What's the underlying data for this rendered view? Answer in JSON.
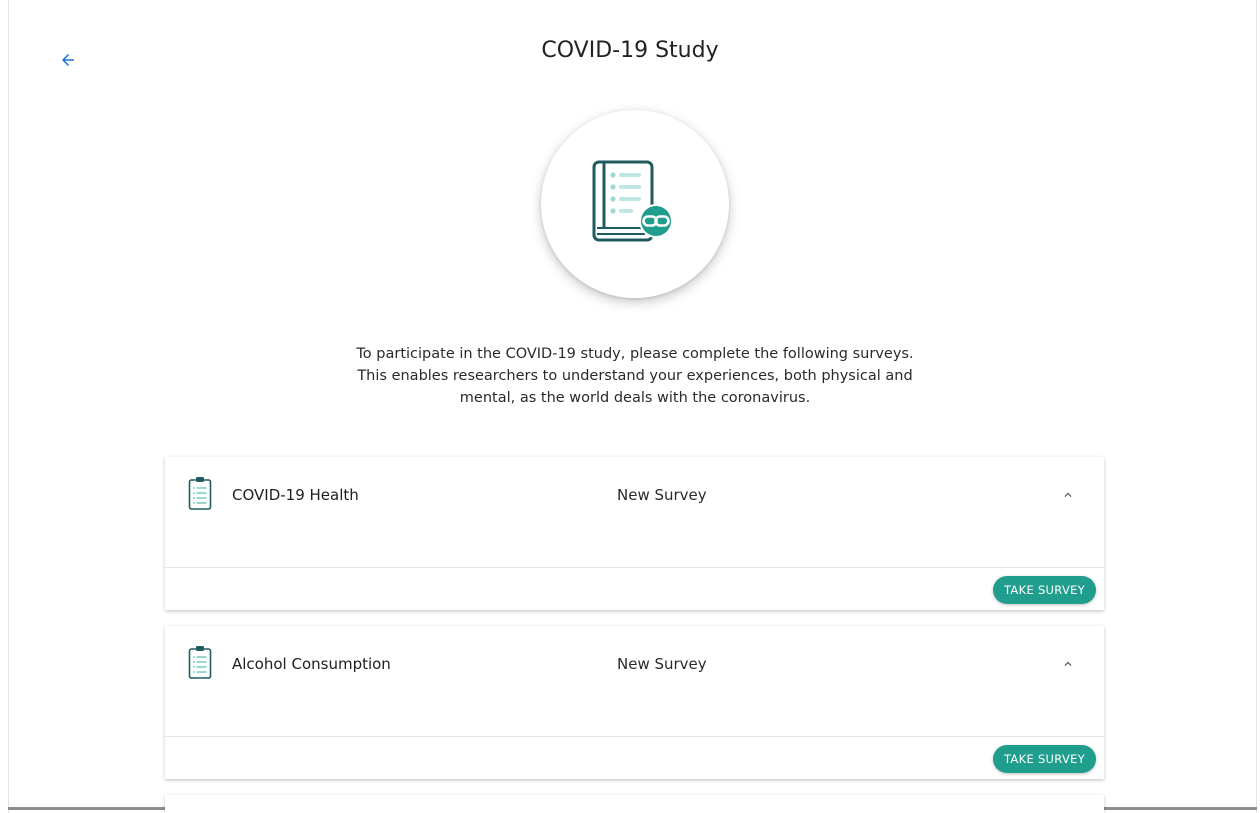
{
  "header": {
    "title": "COVID-19 Study",
    "back_icon": "arrow-left-icon"
  },
  "hero": {
    "icon": "book-link-icon"
  },
  "intro": {
    "text": "To participate in the COVID-19 study, please complete the following surveys. This enables researchers to understand your experiences, both physical and mental, as the world deals with the coronavirus."
  },
  "surveys": [
    {
      "title": "COVID-19 Health",
      "status": "New Survey",
      "button_label": "TAKE SURVEY",
      "icon": "clipboard-icon"
    },
    {
      "title": "Alcohol Consumption",
      "status": "New Survey",
      "button_label": "TAKE SURVEY",
      "icon": "clipboard-icon"
    }
  ],
  "colors": {
    "accent": "#1f9d8d",
    "back_arrow": "#1976d2",
    "icon_dark": "#1f5b5e",
    "icon_light": "#bfe6e2"
  }
}
